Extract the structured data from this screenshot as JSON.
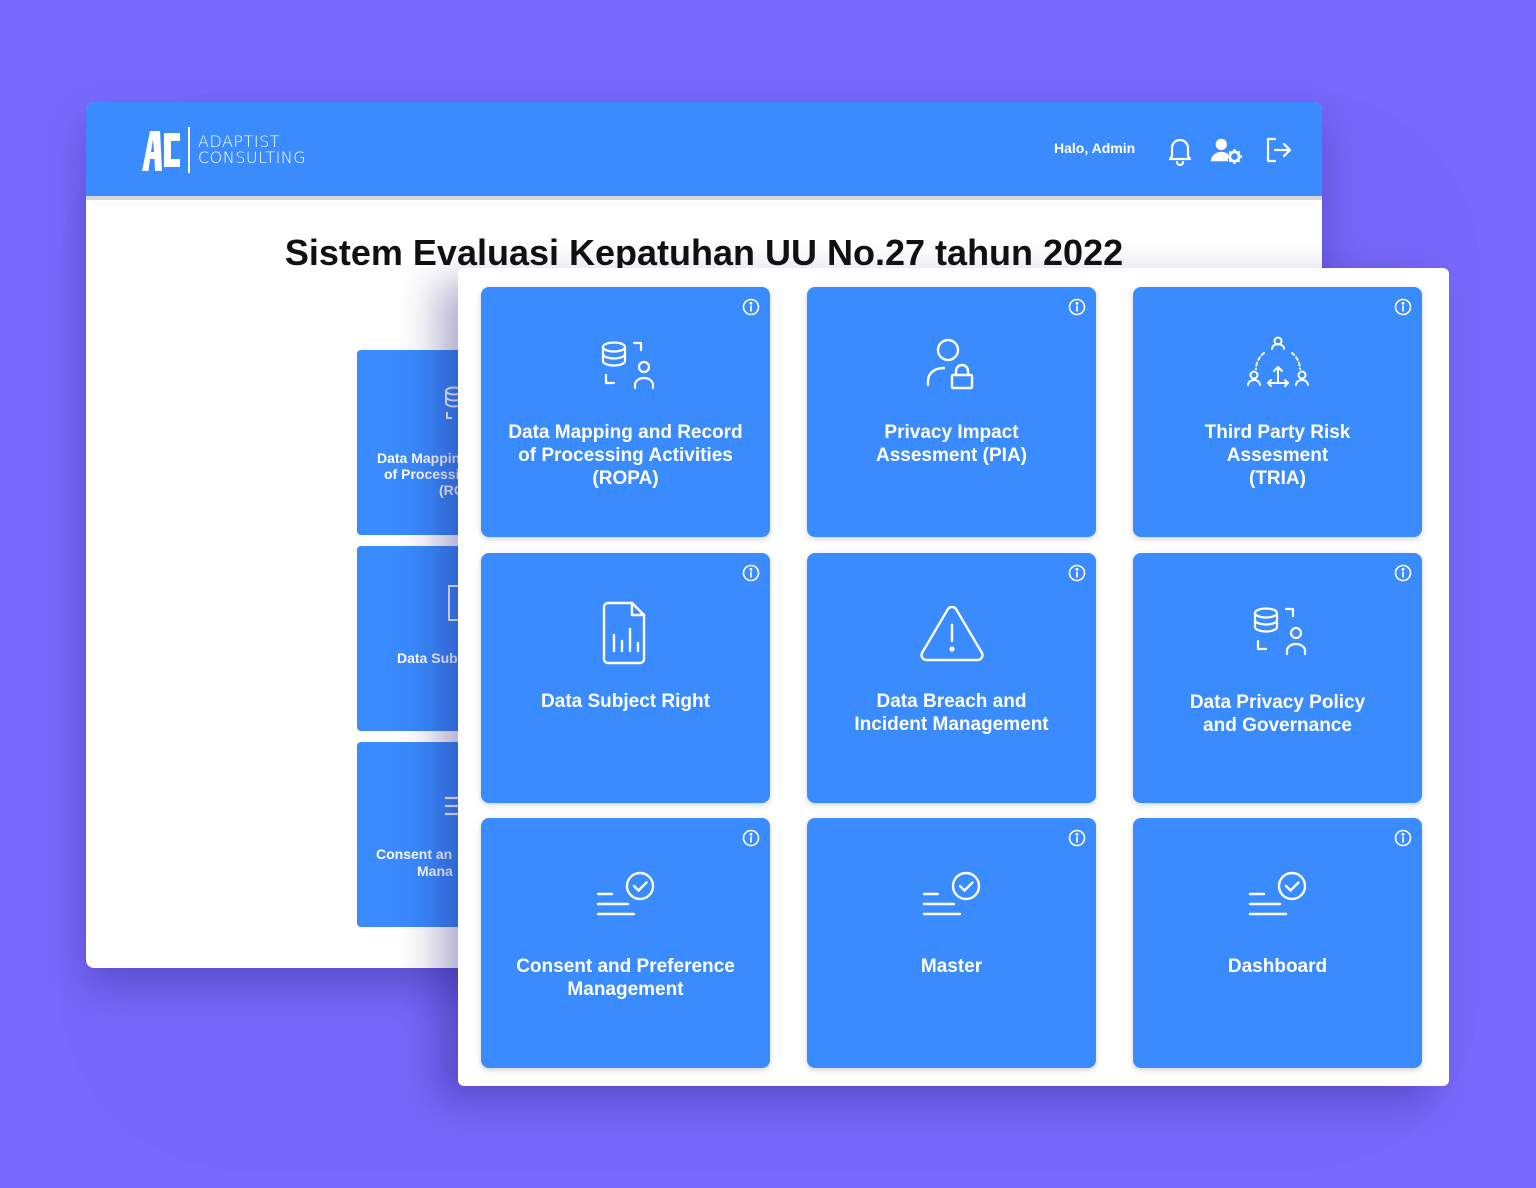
{
  "header": {
    "brand_line1": "ADAPTIST",
    "brand_line2": "CONSULTING",
    "greeting": "Halo, Admin",
    "icons": [
      "bell-icon",
      "user-gear-icon",
      "logout-icon"
    ]
  },
  "page_title": "Sistem Evaluasi Kepatuhan UU No.27 tahun 2022",
  "back_cards": [
    {
      "line1": "Data Mappin",
      "line2": "of Processi",
      "line3": "(RO"
    },
    {
      "line1": "Data Sub"
    },
    {
      "line1": "Consent an",
      "line2": "Mana"
    }
  ],
  "cards": [
    {
      "line1": "Data Mapping and Record",
      "line2": "of Processing Activities",
      "line3": "(ROPA)",
      "icon": "database-user-icon"
    },
    {
      "line1": "Privacy Impact",
      "line2": "Assesment (PIA)",
      "icon": "user-lock-icon"
    },
    {
      "line1": "Third Party Risk",
      "line2": "Assesment",
      "line3": "(TRIA)",
      "icon": "network-users-icon"
    },
    {
      "line1": "Data Subject Right",
      "icon": "document-chart-icon"
    },
    {
      "line1": "Data Breach and",
      "line2": "Incident Management",
      "icon": "warning-icon"
    },
    {
      "line1": "Data Privacy Policy",
      "line2": "and Governance",
      "icon": "database-user-icon"
    },
    {
      "line1": "Consent and Preference",
      "line2": "Management",
      "icon": "list-check-icon"
    },
    {
      "line1": "Master",
      "icon": "list-check-icon"
    },
    {
      "line1": "Dashboard",
      "icon": "list-check-icon"
    }
  ],
  "colors": {
    "background": "#7a6afc",
    "primary": "#3a8bfd",
    "panel": "#ffffff",
    "title": "#111111"
  }
}
